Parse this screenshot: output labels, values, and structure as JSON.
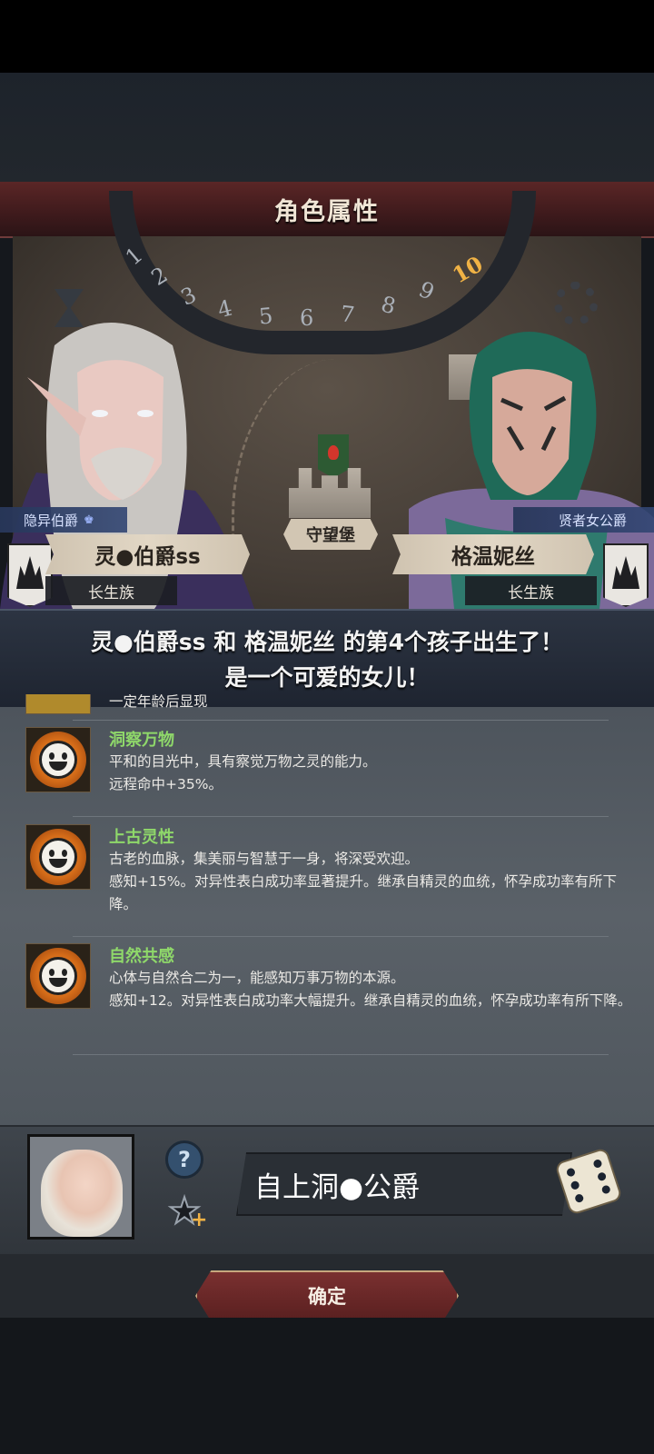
{
  "header": {
    "title": "角色属性"
  },
  "map": {
    "dial_numbers": [
      "1",
      "2",
      "3",
      "4",
      "5",
      "6",
      "7",
      "8",
      "9",
      "10"
    ],
    "current_round": "10",
    "castle_name": "守望堡"
  },
  "father": {
    "title": "隐异伯爵",
    "name": "灵●伯爵ss",
    "race": "长生族"
  },
  "mother": {
    "title": "贤者女公爵",
    "name": "格温妮丝",
    "race": "长生族"
  },
  "announcement": {
    "line1": "灵●伯爵ss 和 格温妮丝 的第4个孩子出生了！",
    "line2": "是一个可爱的女儿！"
  },
  "traits": [
    {
      "name": "",
      "desc": "一定年龄后显现",
      "icon": "smiley-icon"
    },
    {
      "name": "洞察万物",
      "desc": "平和的目光中，具有察觉万物之灵的能力。\n远程命中+35%。",
      "icon": "smiley-icon"
    },
    {
      "name": "上古灵性",
      "desc": "古老的血脉，集美丽与智慧于一身，将深受欢迎。\n感知+15%。对异性表白成功率显著提升。继承自精灵的血统，怀孕成功率有所下降。",
      "icon": "smiley-icon"
    },
    {
      "name": "自然共感",
      "desc": "心体与自然合二为一，能感知万事万物的本源。\n感知+12。对异性表白成功率大幅提升。继承自精灵的血统，怀孕成功率有所下降。",
      "icon": "smiley-icon"
    }
  ],
  "child": {
    "name_value": "自上洞●公爵",
    "help_label": "?",
    "favorite_plus": "+"
  },
  "footer": {
    "confirm_label": "确定"
  }
}
